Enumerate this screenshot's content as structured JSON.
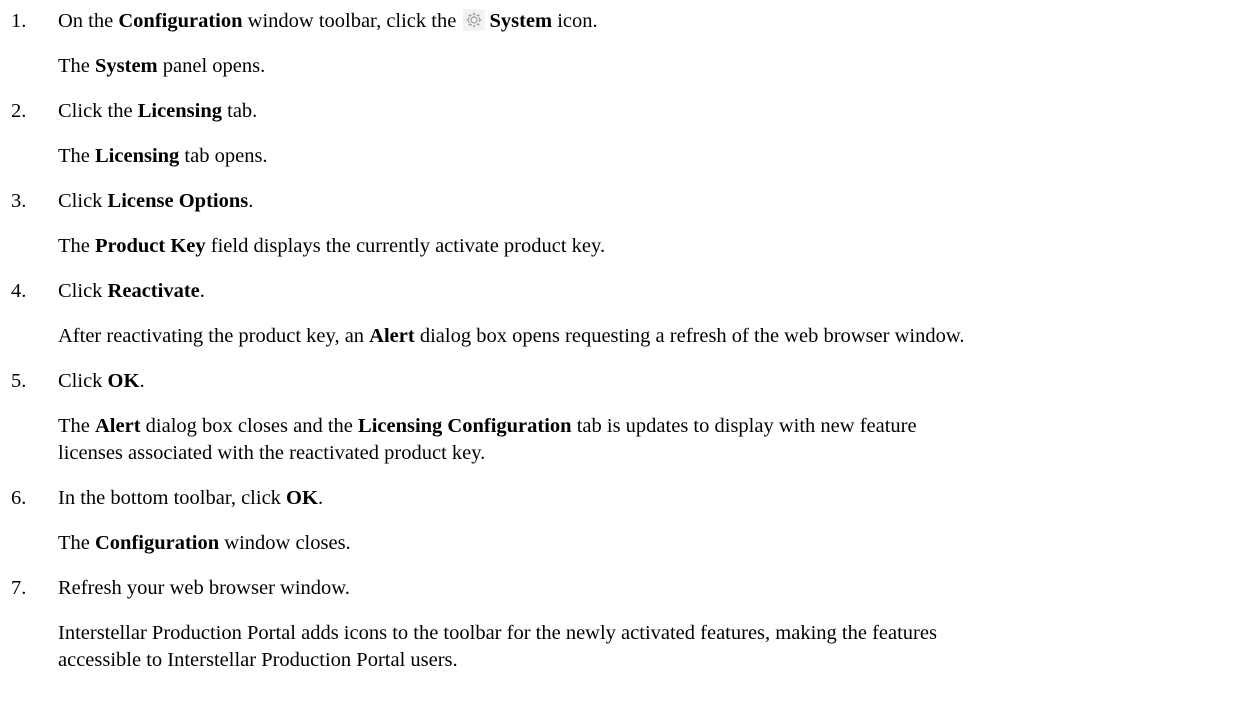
{
  "steps": [
    {
      "number": "1.",
      "instruction": {
        "prefix": "On the",
        "window": "Configuration",
        "middle": "window toolbar, click the",
        "target": "System",
        "suffix": "icon."
      },
      "result": {
        "name": "System",
        "rest": "panel opens."
      }
    },
    {
      "number": "2.",
      "instruction": {
        "prefix": "Click the",
        "target": "Licensing",
        "suffix": "tab."
      },
      "result": {
        "prefix": "The",
        "name": "Licensing",
        "rest": "tab opens."
      }
    },
    {
      "number": "3.",
      "instruction": {
        "prefix": "Click",
        "target": "License Options",
        "suffix": "."
      },
      "result": {
        "prefix": "The",
        "name": "Product Key",
        "rest": "field displays the currently activate product key."
      }
    },
    {
      "number": "4.",
      "instruction": {
        "prefix": "Click",
        "target": "Reactivate",
        "suffix": "."
      },
      "result": {
        "prefix": "After reactivating the product key, an",
        "name": "Alert",
        "rest": "dialog box opens requesting a refresh of the web browser window."
      }
    },
    {
      "number": "5.",
      "instruction": {
        "prefix": "Click",
        "target": "OK",
        "suffix": "."
      },
      "result": {
        "prefix": "The",
        "name": "Alert",
        "middle": "dialog box closes and the",
        "name2": "Licensing Configuration",
        "rest": "tab is updates to display with new feature",
        "line2": "licenses associated with the reactivated product key."
      }
    },
    {
      "number": "6.",
      "instruction": {
        "prefix": "In the bottom toolbar, click",
        "target": "OK",
        "suffix": "."
      },
      "result": {
        "prefix": "The",
        "name": "Configuration",
        "rest": "window closes."
      }
    },
    {
      "number": "7.",
      "instruction": {
        "text": "Refresh your web browser window."
      },
      "result": {
        "line1": "Interstellar Production Portal adds icons to the toolbar for the newly activated features, making the features",
        "line2": "accessible to Interstellar Production Portal users."
      }
    }
  ],
  "step1_result_prefix": "The",
  "icons": {
    "system": "gear-icon"
  }
}
